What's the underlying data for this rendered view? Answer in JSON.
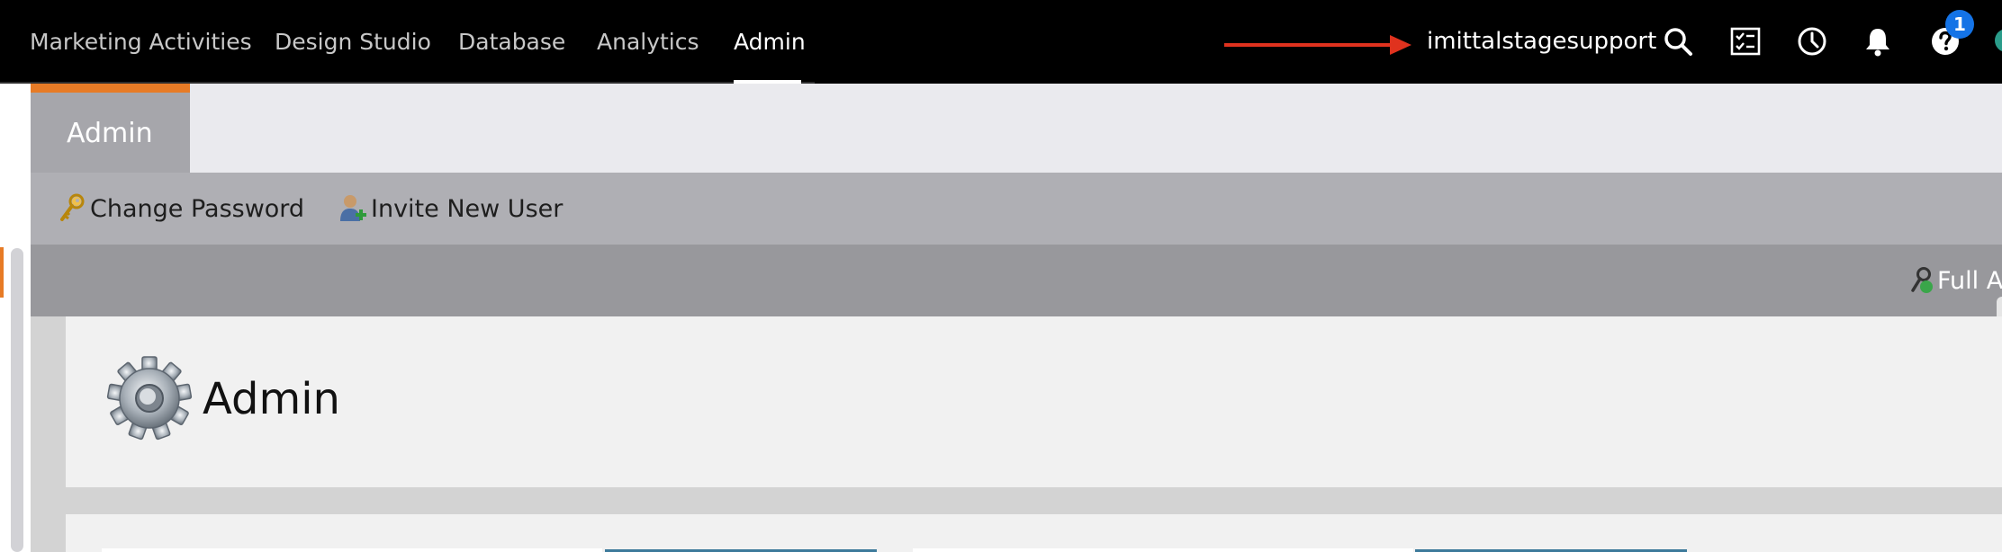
{
  "top_nav": {
    "items": [
      {
        "label": "Marketing Activities",
        "active": false
      },
      {
        "label": "Design Studio",
        "active": false
      },
      {
        "label": "Database",
        "active": false
      },
      {
        "label": "Analytics",
        "active": false
      },
      {
        "label": "Admin",
        "active": true
      }
    ],
    "username": "imittalstagesupport",
    "icons": [
      "search-icon",
      "task-list-icon",
      "clock-icon",
      "bell-icon",
      "help-icon"
    ],
    "help_badge": "1",
    "arrow_color": "#e0321e"
  },
  "workspace": {
    "tab_label": "Admin",
    "accent_color": "#e77b26"
  },
  "toolbar": {
    "change_password": "Change Password",
    "invite_new_user": "Invite New User"
  },
  "access": {
    "label": "Full Ac"
  },
  "content": {
    "title": "Admin"
  }
}
